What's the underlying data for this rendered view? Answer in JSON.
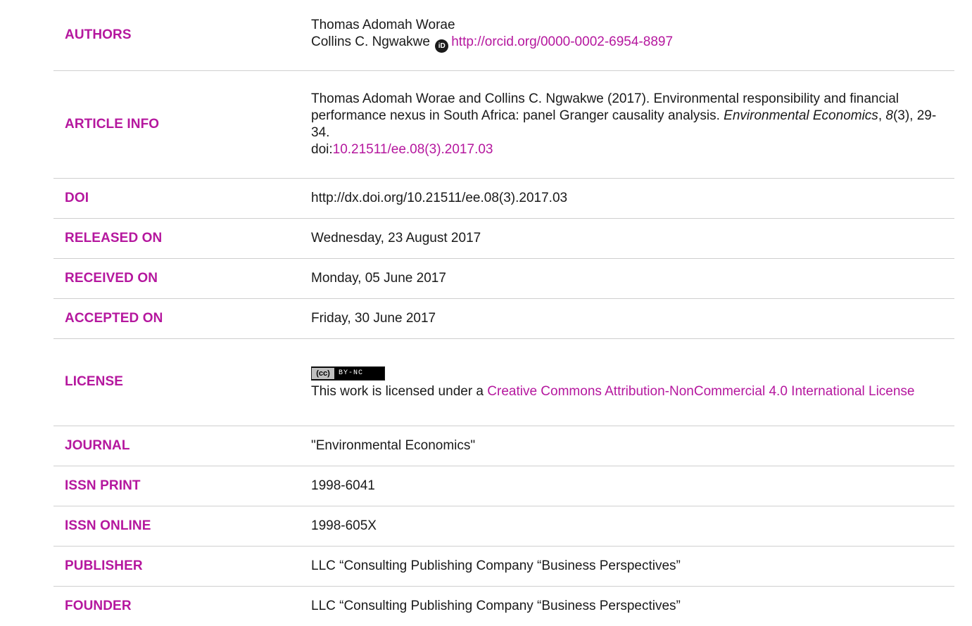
{
  "labels": {
    "authors": "AUTHORS",
    "article_info": "ARTICLE INFO",
    "doi": "DOI",
    "released_on": "RELEASED ON",
    "received_on": "RECEIVED ON",
    "accepted_on": "ACCEPTED ON",
    "license": "LICENSE",
    "journal": "JOURNAL",
    "issn_print": "ISSN PRINT",
    "issn_online": "ISSN ONLINE",
    "publisher": "PUBLISHER",
    "founder": "FOUNDER"
  },
  "authors": {
    "author1": "Thomas Adomah Worae",
    "author2": "Collins C. Ngwakwe",
    "orcid_glyph": "iD",
    "orcid_url": "http://orcid.org/0000-0002-6954-8897"
  },
  "article_info": {
    "citation_prefix": "Thomas Adomah Worae and Collins C. Ngwakwe (2017). Environmental responsibility and financial performance nexus in South Africa: panel Granger causality analysis. ",
    "journal_name": "Environmental Economics",
    "sep1": ", ",
    "volume": "8",
    "issue_pages": "(3), 29-34.",
    "doi_prefix": "doi:",
    "doi_link": "10.21511/ee.08(3).2017.03"
  },
  "doi_url": "http://dx.doi.org/10.21511/ee.08(3).2017.03",
  "released_on": "Wednesday, 23 August 2017",
  "received_on": "Monday, 05 June 2017",
  "accepted_on": "Friday, 30 June 2017",
  "license": {
    "badge_cc": "(cc)",
    "badge_text": "BY-NC",
    "text_prefix": "This work is licensed under a ",
    "link_text": "Creative Commons Attribution-NonCommercial 4.0 International License"
  },
  "journal": "\"Environmental Economics\"",
  "issn_print": "1998-6041",
  "issn_online": "1998-605X",
  "publisher": "LLC “Consulting Publishing Company “Business Perspectives”",
  "founder": "LLC “Consulting Publishing Company “Business Perspectives”",
  "colors": {
    "label": "#b5179e",
    "link": "#b5179e",
    "text": "#1a1a1a",
    "divider": "#cfcfcf"
  }
}
